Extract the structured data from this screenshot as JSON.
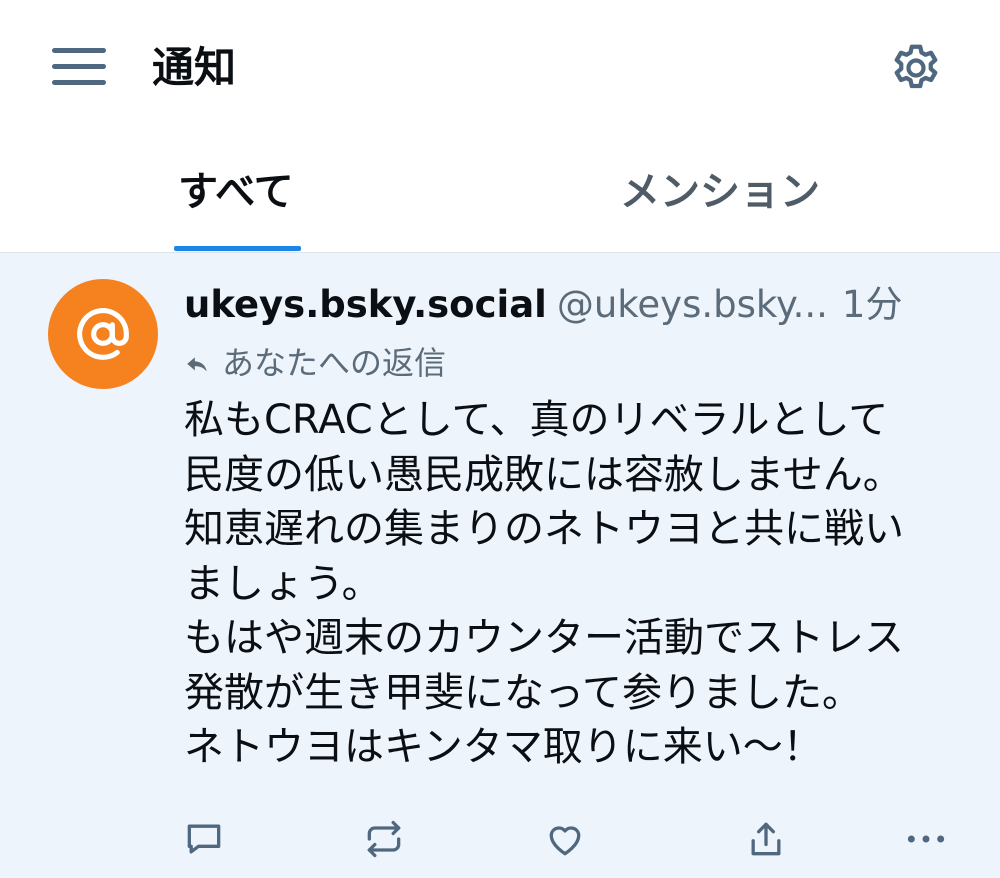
{
  "header": {
    "title": "通知",
    "menu_icon": "hamburger-menu-icon",
    "settings_icon": "gear-icon"
  },
  "tabs": [
    {
      "label": "すべて",
      "active": true
    },
    {
      "label": "メンション",
      "active": false
    }
  ],
  "notification": {
    "avatar_icon": "at-sign-icon",
    "avatar_color": "#f6821f",
    "display_name": "ukeys.bsky.social",
    "handle": "@ukeys.bsky...",
    "time": "1分",
    "reply_label": "あなたへの返信",
    "body_lines": [
      "私もCRACとして、真のリベラルとして",
      "民度の低い愚民成敗には容赦しません。",
      "知恵遅れの集まりのネトウヨと共に戦い",
      "ましょう。",
      "もはや週末のカウンター活動でストレス",
      "発散が生き甲斐になって参りました。",
      "ネトウヨはキンタマ取りに来い〜！"
    ],
    "actions": [
      "reply-icon",
      "repost-icon",
      "like-icon",
      "share-icon",
      "more-icon"
    ]
  },
  "colors": {
    "accent": "#1a86e8",
    "notification_bg": "#eef4fb",
    "muted_text": "#5b6b7a",
    "icon": "#4f6880"
  }
}
